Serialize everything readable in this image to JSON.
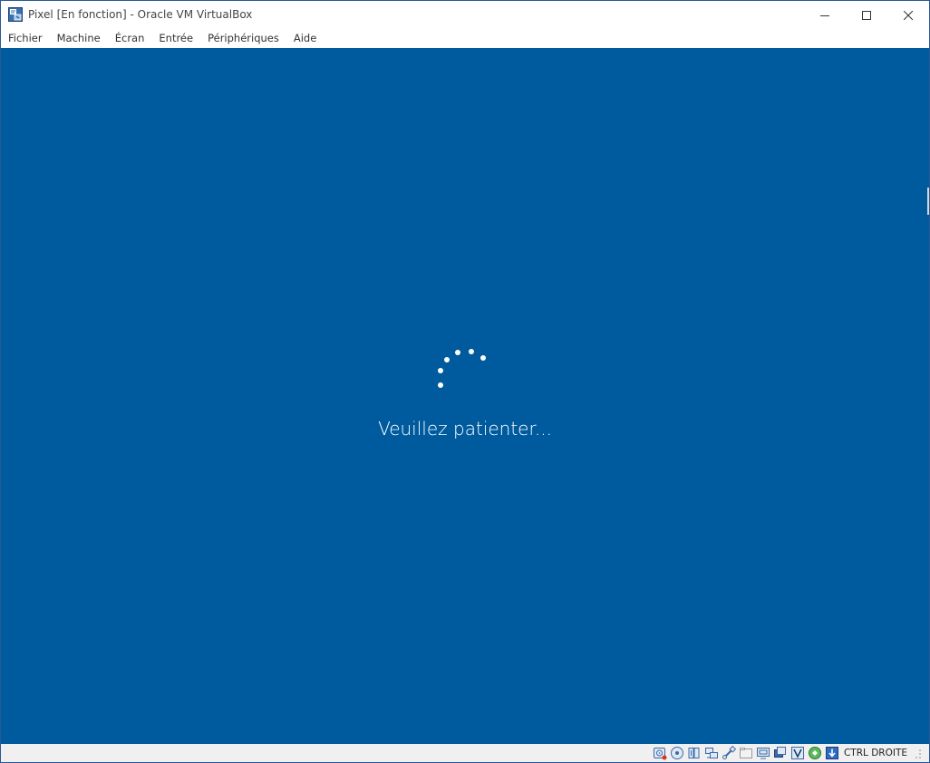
{
  "window": {
    "title": "Pixel [En fonction] - Oracle VM VirtualBox",
    "minimize_glyph": "minimize-icon",
    "maximize_glyph": "maximize-icon",
    "close_glyph": "close-icon",
    "app_icon": "virtualbox-icon"
  },
  "menubar": {
    "items": [
      "Fichier",
      "Machine",
      "Écran",
      "Entrée",
      "Périphériques",
      "Aide"
    ]
  },
  "guest": {
    "background_color": "#005a9e",
    "spinner_icon": "loading-spinner-icon",
    "message": "Veuillez patienter..."
  },
  "statusbar": {
    "icons": [
      "hard-disk-icon",
      "optical-drive-icon",
      "audio-icon",
      "network-icon",
      "usb-icon",
      "shared-folders-icon",
      "display-icon",
      "video-capture-icon",
      "virtualization-icon",
      "mouse-integration-icon",
      "keyboard-capture-icon"
    ],
    "host_key": "CTRL DROITE"
  }
}
